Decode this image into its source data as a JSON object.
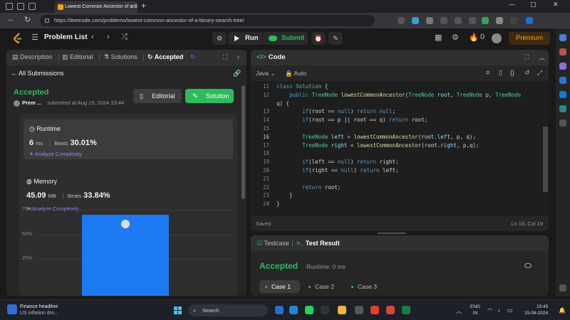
{
  "browser": {
    "tab_title": "Lowest Common Ancestor of a B",
    "url": "https://leetcode.com/problems/lowest-common-ancestor-of-a-binary-search-tree/"
  },
  "header": {
    "problem_list": "Problem List",
    "run_label": "Run",
    "submit_label": "Submit",
    "streak_count": "0",
    "premium_label": "Premium"
  },
  "left_tabs": [
    {
      "label": "Description"
    },
    {
      "label": "Editorial"
    },
    {
      "label": "Solutions"
    },
    {
      "label": "Accepted"
    }
  ],
  "submission": {
    "back_label": "All Submissions",
    "status": "Accepted",
    "author": "Prem ...",
    "submitted_at": "submitted at Aug 15, 2024 19:44",
    "editorial_btn": "Editorial",
    "solution_btn": "Solution",
    "runtime": {
      "title": "Runtime",
      "value": "6",
      "unit": "ms",
      "beats_label": "Beats",
      "beats_value": "30.01%",
      "analyze": "Analyze Complexity"
    },
    "memory": {
      "title": "Memory",
      "value": "45.09",
      "unit": "MB",
      "beats_label": "Beats",
      "beats_value": "33.84%",
      "analyze": "Analyze Complexity"
    }
  },
  "chart_data": {
    "type": "bar",
    "ytick_labels": [
      "75%",
      "50%",
      "25%"
    ],
    "ylim": [
      0,
      100
    ],
    "values": [
      70
    ],
    "grid": true,
    "color": "#1d7af2"
  },
  "code_panel": {
    "title": "Code",
    "language": "Java",
    "mode": "Auto",
    "saved": "Saved",
    "cursor": "Ln 16, Col 19"
  },
  "code_lines": [
    {
      "n": "11",
      "html": "<span class='kw'>class</span> <span class='ty'>Solution</span> {"
    },
    {
      "n": "12",
      "html": "    <span class='kw'>public</span> <span class='ty'>TreeNode</span> <span class='fn'>lowestCommonAncestor</span>(<span class='ty'>TreeNode</span> <span class='vr'>root</span>, <span class='ty'>TreeNode</span> <span class='vr'>p</span>, <span class='ty'>TreeNode</span>"
    },
    {
      "n": "",
      "html": "<span class='vr'>q</span>) {"
    },
    {
      "n": "13",
      "html": "        <span class='kw'>if</span>(root == <span class='kw'>null</span>) <span class='kw'>return</span> <span class='kw'>null</span>;"
    },
    {
      "n": "14",
      "html": "        <span class='kw'>if</span>(root == p || root == q) <span class='kw'>return</span> root;"
    },
    {
      "n": "15",
      "html": ""
    },
    {
      "n": "16",
      "html": "        <span class='ty'>TreeNode</span> <span class='vr'>left</span> = <span class='fn'>lowestCommonAncestor</span>(root.<span class='vr'>left</span>, p, q);",
      "hl": true
    },
    {
      "n": "17",
      "html": "        <span class='ty'>TreeNode</span> <span class='vr'>right</span> = <span class='fn'>lowestCommonAncestor</span>(root.<span class='vr'>right</span>, p,q);"
    },
    {
      "n": "18",
      "html": ""
    },
    {
      "n": "19",
      "html": "        <span class='kw'>if</span>(left == <span class='kw'>null</span>) <span class='kw'>return</span> right;"
    },
    {
      "n": "20",
      "html": "        <span class='kw'>if</span>(right == <span class='kw'>null</span>) <span class='kw'>return</span> left;"
    },
    {
      "n": "21",
      "html": ""
    },
    {
      "n": "22",
      "html": "        <span class='kw'>return</span> root;"
    },
    {
      "n": "23",
      "html": "    }"
    },
    {
      "n": "24",
      "html": "}"
    }
  ],
  "test_panel": {
    "testcase_tab": "Testcase",
    "result_tab": "Test Result",
    "status": "Accepted",
    "runtime": "Runtime: 0 ms",
    "cases": [
      "Case 1",
      "Case 2",
      "Case 3"
    ]
  },
  "taskbar": {
    "news_title": "Finance headline",
    "news_sub": "US inflation dro...",
    "search": "Search",
    "lang_top": "ENG",
    "lang_bottom": "IN",
    "time": "19:45",
    "date": "15-08-2024"
  }
}
